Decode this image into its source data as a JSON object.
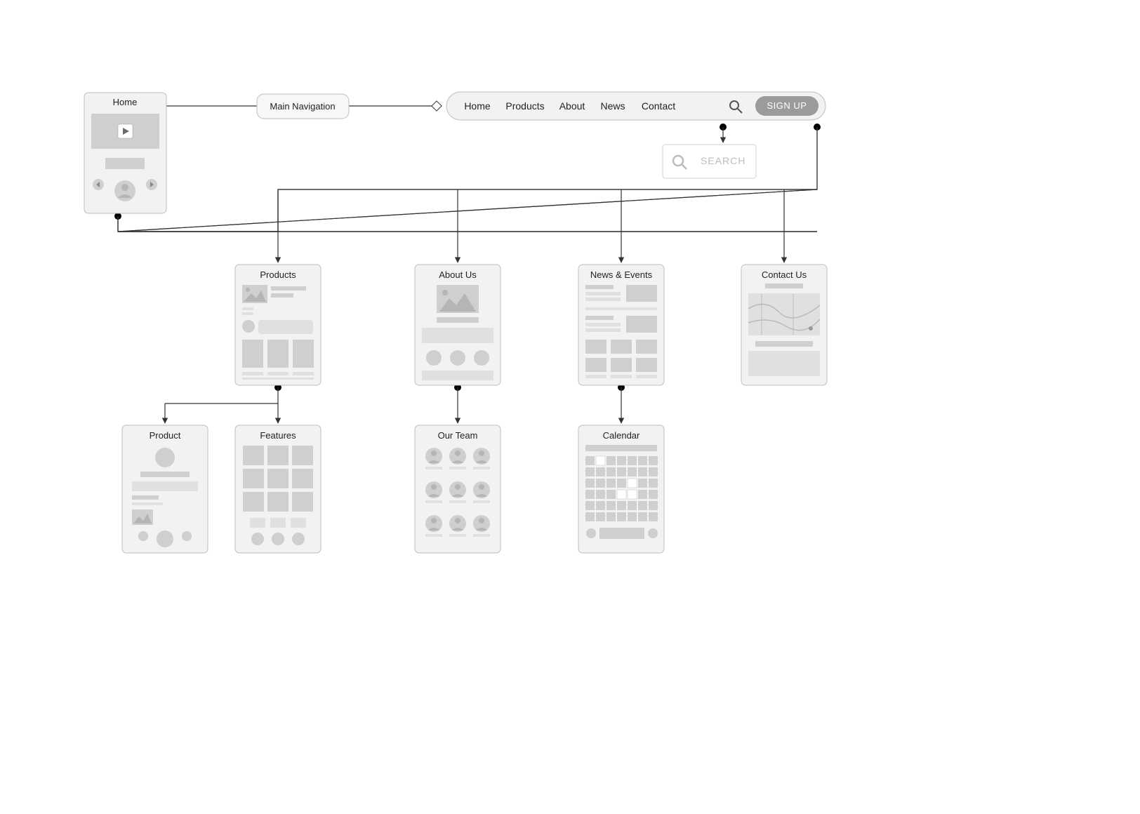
{
  "home": {
    "title": "Home"
  },
  "mainNav": {
    "label": "Main Navigation"
  },
  "nav": {
    "items": [
      "Home",
      "Products",
      "About",
      "News",
      "Contact"
    ],
    "signup": "SIGN UP"
  },
  "searchBox": {
    "placeholder": "SEARCH"
  },
  "pages": {
    "products": {
      "title": "Products"
    },
    "about": {
      "title": "About Us"
    },
    "news": {
      "title": "News & Events"
    },
    "contact": {
      "title": "Contact Us"
    },
    "product": {
      "title": "Product"
    },
    "features": {
      "title": "Features"
    },
    "team": {
      "title": "Our Team"
    },
    "calendar": {
      "title": "Calendar"
    }
  }
}
